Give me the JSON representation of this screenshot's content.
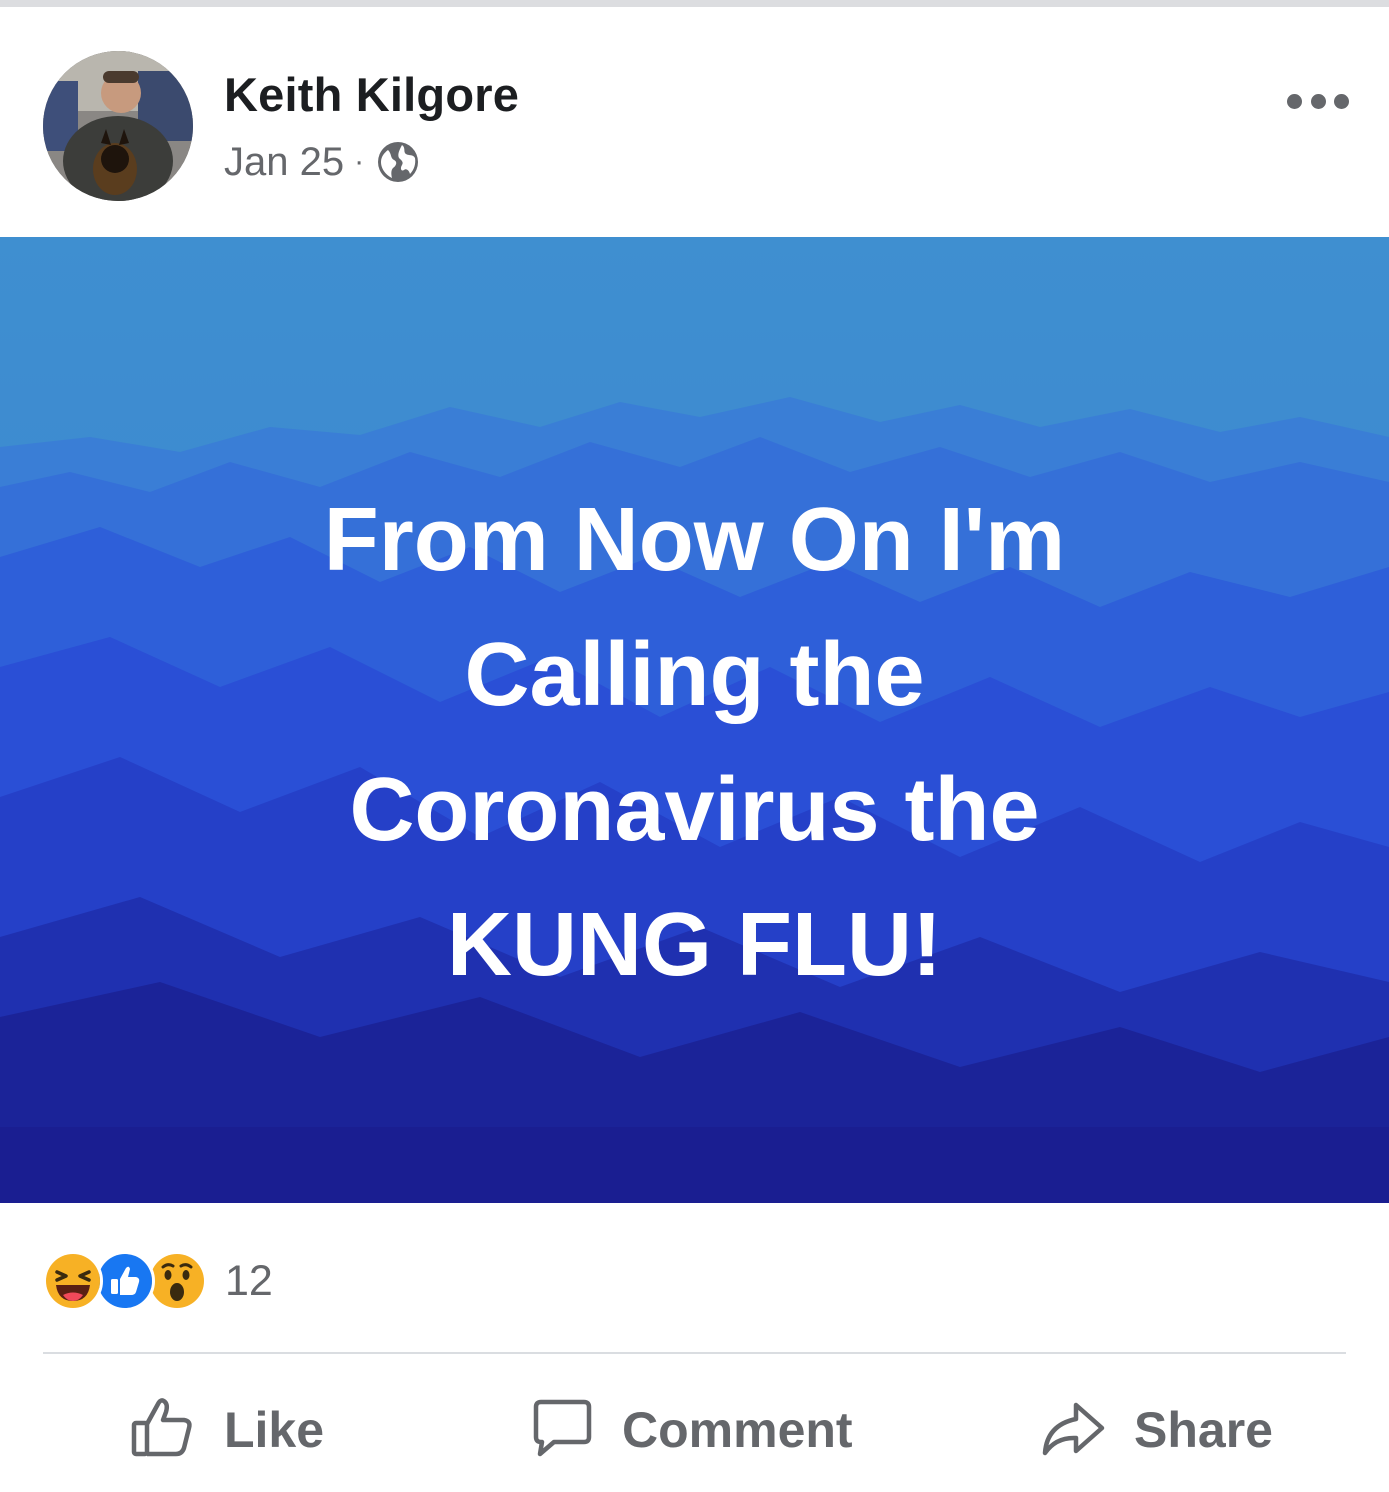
{
  "post": {
    "author": "Keith Kilgore",
    "date": "Jan 25",
    "separator": "·",
    "privacy_icon": "globe-icon",
    "more_icon": "more-options-icon",
    "banner": {
      "lines": [
        "From Now On I'm",
        "Calling the",
        "Coronavirus the",
        "KUNG FLU!"
      ],
      "background": "blue-mountains",
      "text_color": "#ffffff"
    },
    "reactions": {
      "icons": [
        "haha-icon",
        "like-reaction-icon",
        "wow-icon"
      ],
      "count": "12"
    },
    "actions": {
      "like": {
        "label": "Like",
        "icon": "thumbs-up-icon"
      },
      "comment": {
        "label": "Comment",
        "icon": "comment-bubble-icon"
      },
      "share": {
        "label": "Share",
        "icon": "share-arrow-icon"
      }
    }
  },
  "colors": {
    "secondary_text": "#65676b",
    "like_blue": "#1877f2",
    "emoji_yellow": "#f7b125",
    "banner_top": "#3f8fd0",
    "banner_bottom": "#1a1a8c"
  }
}
